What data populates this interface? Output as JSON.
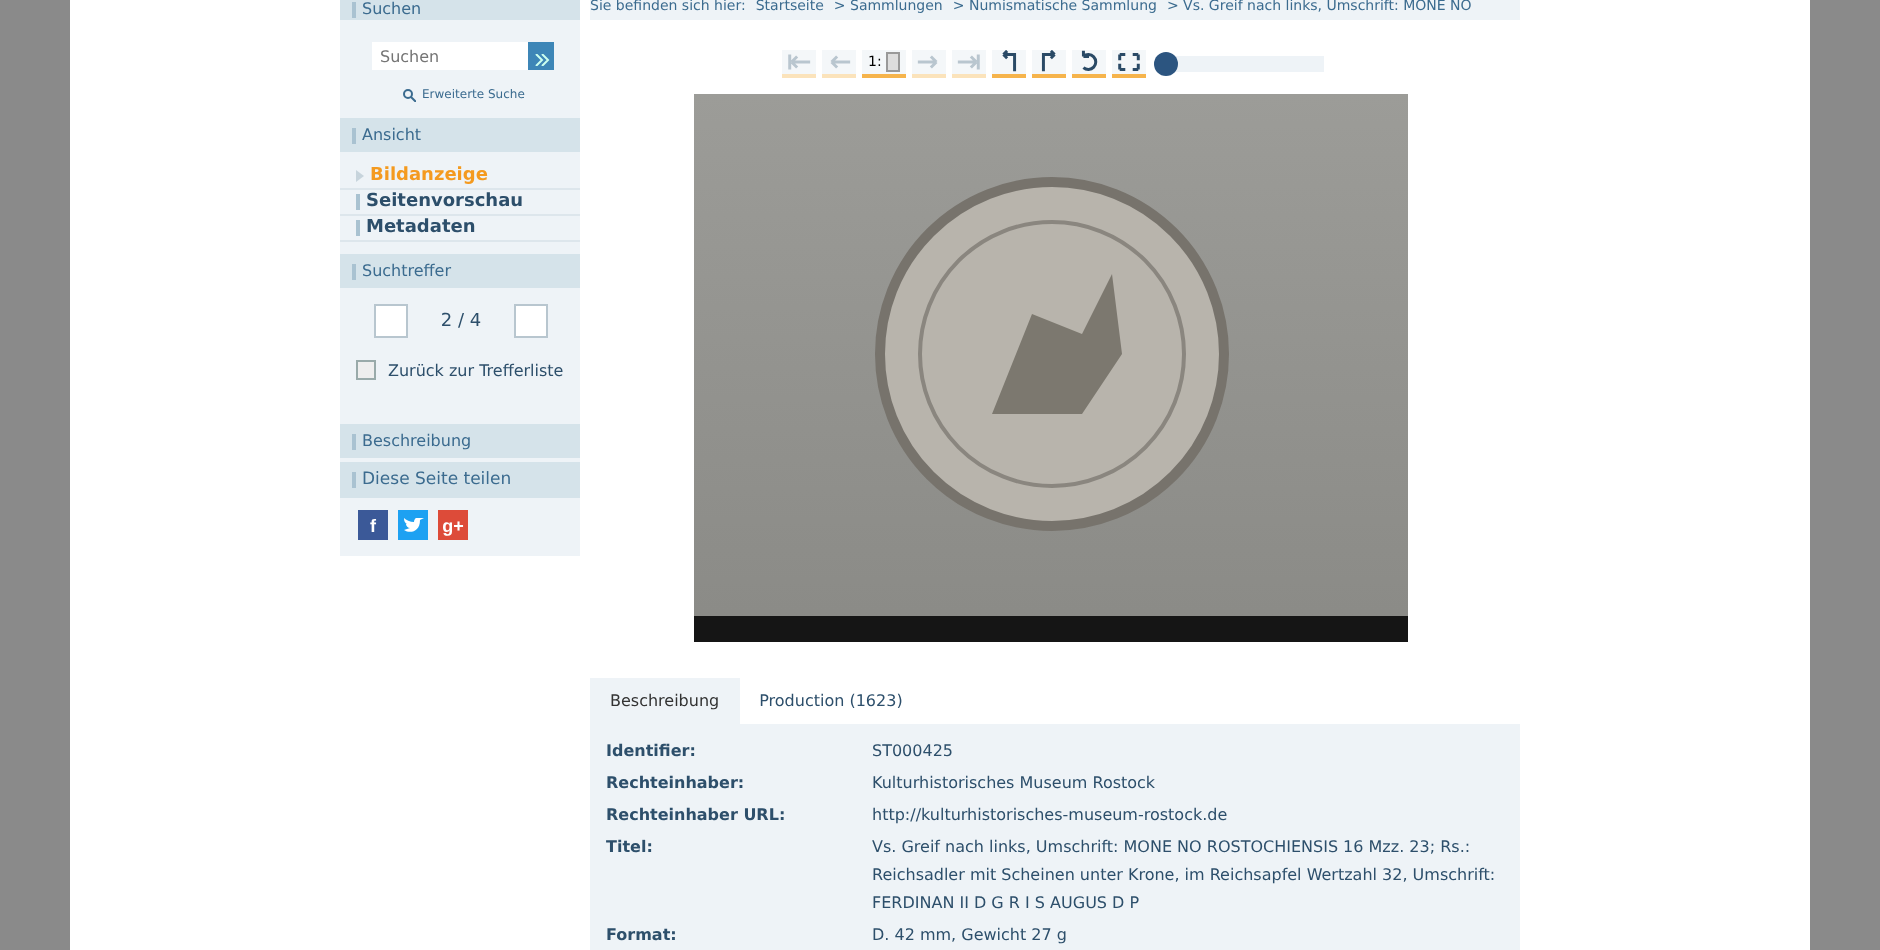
{
  "sidebar": {
    "search": {
      "header": "Suchen",
      "placeholder": "Suchen",
      "advanced": "Erweiterte Suche"
    },
    "view": {
      "header": "Ansicht",
      "items": [
        {
          "label": "Bildanzeige",
          "selected": true
        },
        {
          "label": "Seitenvorschau",
          "selected": false
        },
        {
          "label": "Metadaten",
          "selected": false
        }
      ]
    },
    "hits": {
      "header": "Suchtreffer",
      "counter": "2 / 4",
      "back": "Zurück zur Trefferliste"
    },
    "description": {
      "header": "Beschreibung"
    },
    "share": {
      "header": "Diese Seite teilen",
      "networks": [
        {
          "kind": "facebook",
          "label": "f"
        },
        {
          "kind": "twitter"
        },
        {
          "kind": "googleplus",
          "label": "g+"
        }
      ]
    }
  },
  "breadcrumb": {
    "label": "Sie befinden sich hier:",
    "items": [
      "Startseite",
      "> Sammlungen",
      "> Numismatische Sammlung",
      "> Vs. Greif nach links, Umschrift: MONE NO"
    ]
  },
  "toolbar": {
    "buttons": [
      {
        "kind": "first",
        "disabled": true
      },
      {
        "kind": "prev",
        "disabled": true
      },
      {
        "kind": "page",
        "value": "1:"
      },
      {
        "kind": "next",
        "disabled": true
      },
      {
        "kind": "last",
        "disabled": true
      },
      {
        "kind": "rotate-left",
        "disabled": false
      },
      {
        "kind": "rotate-right",
        "disabled": false
      },
      {
        "kind": "reset",
        "disabled": false
      },
      {
        "kind": "fullscreen",
        "disabled": false
      }
    ],
    "zoom": {
      "level": 0
    }
  },
  "tabs": [
    {
      "label": "Beschreibung",
      "selected": true
    },
    {
      "label": "Production (1623)",
      "selected": false
    }
  ],
  "metadata": [
    {
      "label": "Identifier:",
      "value": "ST000425"
    },
    {
      "label": "Rechteinhaber:",
      "value": "Kulturhistorisches Museum Rostock"
    },
    {
      "label": "Rechteinhaber URL:",
      "value": "http://kulturhistorisches-museum-rostock.de"
    },
    {
      "label": "Titel:",
      "value": "Vs. Greif nach links, Umschrift: MONE NO ROSTOCHIENSIS 16 Mzz. 23; Rs.: Reichsadler mit Scheinen unter Krone, im Reichsapfel Wertzahl 32, Umschrift: FERDINAN II D G R I S AUGUS D P"
    },
    {
      "label": "Format:",
      "value": "D. 42 mm, Gewicht 27 g"
    }
  ]
}
